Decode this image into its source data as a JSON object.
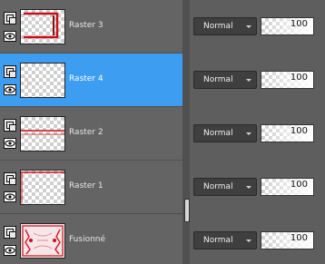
{
  "layers": [
    {
      "name": "Raster 3",
      "blend_mode": "Normal",
      "opacity": "100",
      "selected": false,
      "thumb": "raster3-art"
    },
    {
      "name": "Raster 4",
      "blend_mode": "Normal",
      "opacity": "100",
      "selected": true,
      "thumb": "raster4-art"
    },
    {
      "name": "Raster 2",
      "blend_mode": "Normal",
      "opacity": "100",
      "selected": false,
      "thumb": "raster2-art"
    },
    {
      "name": "Raster 1",
      "blend_mode": "Normal",
      "opacity": "100",
      "selected": false,
      "thumb": "raster1-art"
    },
    {
      "name": "Fusionné",
      "blend_mode": "Normal",
      "opacity": "100",
      "selected": false,
      "thumb": "fusionne-art"
    }
  ],
  "colors": {
    "selected_row": "#3d9df0",
    "thumb_accent": "#c8101a"
  }
}
